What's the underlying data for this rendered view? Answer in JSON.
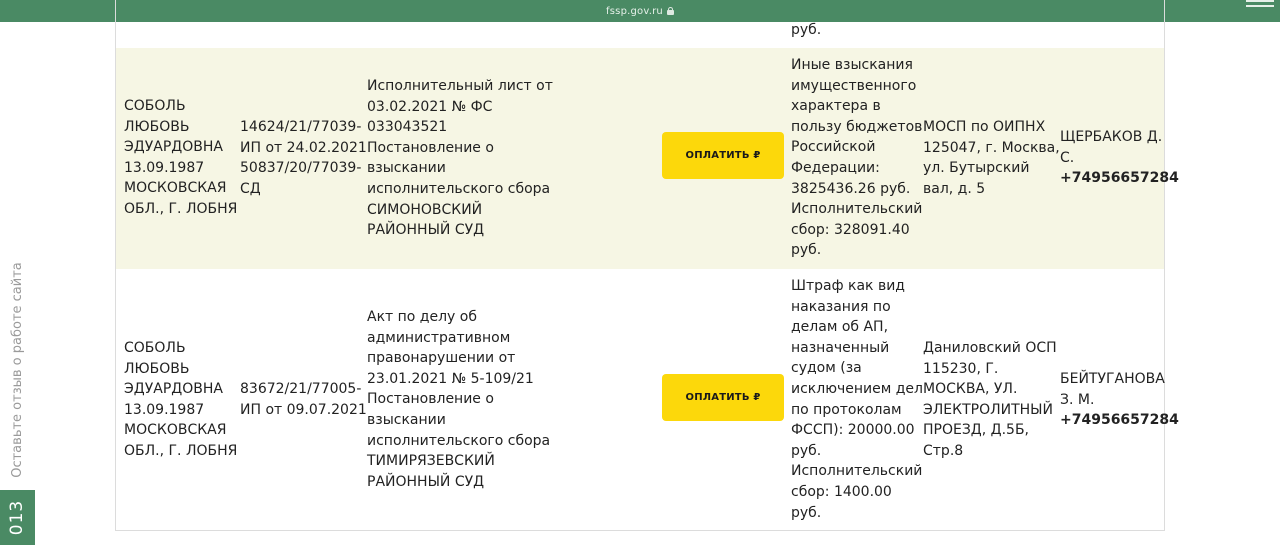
{
  "browser": {
    "domain": "fssp.gov.ru"
  },
  "colors": {
    "accent_green": "#4a8a64",
    "pay_button": "#fcd80b",
    "row_highlight": "#f6f6e4"
  },
  "side": {
    "feedback": "Оставьте отзыв о работе сайта",
    "badge": "013"
  },
  "top_row_tail": [
    "руб."
  ],
  "pay_label": "ОПЛАТИТЬ ₽",
  "rows": [
    {
      "debtor": [
        "СОБОЛЬ",
        "ЛЮБОВЬ",
        "ЭДУАРДОВНА",
        "13.09.1987",
        "МОСКОВСКАЯ",
        "ОБЛ., Г. ЛОБНЯ"
      ],
      "proceeding": [
        "14624/21/77039-",
        "ИП от 24.02.2021",
        "50837/20/77039-",
        "СД"
      ],
      "document": [
        "Исполнительный лист от",
        "03.02.2021 № ФС",
        "033043521",
        "Постановление о",
        "взыскании",
        "исполнительского сбора",
        "СИМОНОВСКИЙ",
        "РАЙОННЫЙ СУД"
      ],
      "subject": [
        "Иные взыскания",
        "имущественного",
        "характера в",
        "пользу бюджетов",
        "Российской",
        "Федерации:",
        "3825436.26 руб.",
        "Исполнительский",
        "сбор: 328091.40",
        "руб."
      ],
      "department": [
        "МОСП по ОИПНХ",
        "125047, г. Москва,",
        "ул. Бутырский",
        "вал, д. 5"
      ],
      "bailiff": [
        "ЩЕРБАКОВ Д.",
        "С."
      ],
      "phone": "+74956657284"
    },
    {
      "debtor": [
        "СОБОЛЬ",
        "ЛЮБОВЬ",
        "ЭДУАРДОВНА",
        "13.09.1987",
        "МОСКОВСКАЯ",
        "ОБЛ., Г. ЛОБНЯ"
      ],
      "proceeding": [
        "83672/21/77005-",
        "ИП от 09.07.2021"
      ],
      "document": [
        "Акт по делу об",
        "административном",
        "правонарушении от",
        "23.01.2021 № 5-109/21",
        "Постановление о",
        "взыскании",
        "исполнительского сбора",
        "ТИМИРЯЗЕВСКИЙ",
        "РАЙОННЫЙ СУД"
      ],
      "subject": [
        "Штраф как вид",
        "наказания по",
        "делам об АП,",
        "назначенный",
        "судом (за",
        "исключением дел",
        "по протоколам",
        "ФССП): 20000.00",
        "руб.",
        "Исполнительский",
        "сбор: 1400.00",
        "руб."
      ],
      "department": [
        "Даниловский ОСП",
        "115230, Г.",
        "МОСКВА, УЛ.",
        "ЭЛЕКТРОЛИТНЫЙ",
        "ПРОЕЗД, Д.5Б,",
        "Стр.8"
      ],
      "bailiff": [
        "БЕЙТУГАНОВА",
        "З. М."
      ],
      "phone": "+74956657284"
    }
  ]
}
